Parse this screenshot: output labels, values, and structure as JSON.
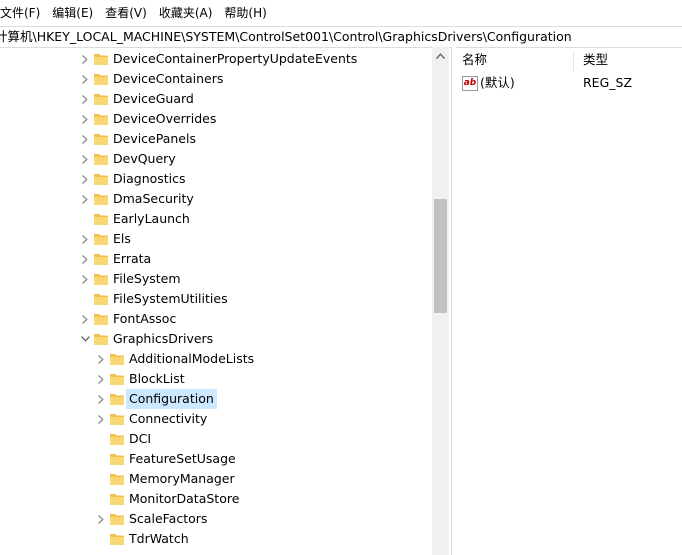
{
  "menubar": {
    "items": [
      "文件(F)",
      "编辑(E)",
      "查看(V)",
      "收藏夹(A)",
      "帮助(H)"
    ]
  },
  "address": {
    "path": "计算机\\HKEY_LOCAL_MACHINE\\SYSTEM\\ControlSet001\\Control\\GraphicsDrivers\\Configuration"
  },
  "tree": {
    "items": [
      {
        "label": "DeviceContainerPropertyUpdateEvents",
        "level": 1,
        "expandable": true,
        "expanded": false
      },
      {
        "label": "DeviceContainers",
        "level": 1,
        "expandable": true,
        "expanded": false
      },
      {
        "label": "DeviceGuard",
        "level": 1,
        "expandable": true,
        "expanded": false
      },
      {
        "label": "DeviceOverrides",
        "level": 1,
        "expandable": true,
        "expanded": false
      },
      {
        "label": "DevicePanels",
        "level": 1,
        "expandable": true,
        "expanded": false
      },
      {
        "label": "DevQuery",
        "level": 1,
        "expandable": true,
        "expanded": false
      },
      {
        "label": "Diagnostics",
        "level": 1,
        "expandable": true,
        "expanded": false
      },
      {
        "label": "DmaSecurity",
        "level": 1,
        "expandable": true,
        "expanded": false
      },
      {
        "label": "EarlyLaunch",
        "level": 1,
        "expandable": false,
        "expanded": false
      },
      {
        "label": "Els",
        "level": 1,
        "expandable": true,
        "expanded": false
      },
      {
        "label": "Errata",
        "level": 1,
        "expandable": true,
        "expanded": false
      },
      {
        "label": "FileSystem",
        "level": 1,
        "expandable": true,
        "expanded": false
      },
      {
        "label": "FileSystemUtilities",
        "level": 1,
        "expandable": false,
        "expanded": false
      },
      {
        "label": "FontAssoc",
        "level": 1,
        "expandable": true,
        "expanded": false
      },
      {
        "label": "GraphicsDrivers",
        "level": 1,
        "expandable": true,
        "expanded": true
      },
      {
        "label": "AdditionalModeLists",
        "level": 2,
        "expandable": true,
        "expanded": false
      },
      {
        "label": "BlockList",
        "level": 2,
        "expandable": true,
        "expanded": false
      },
      {
        "label": "Configuration",
        "level": 2,
        "expandable": true,
        "expanded": false,
        "selected": true
      },
      {
        "label": "Connectivity",
        "level": 2,
        "expandable": true,
        "expanded": false
      },
      {
        "label": "DCI",
        "level": 2,
        "expandable": false,
        "expanded": false
      },
      {
        "label": "FeatureSetUsage",
        "level": 2,
        "expandable": false,
        "expanded": false
      },
      {
        "label": "MemoryManager",
        "level": 2,
        "expandable": false,
        "expanded": false
      },
      {
        "label": "MonitorDataStore",
        "level": 2,
        "expandable": false,
        "expanded": false
      },
      {
        "label": "ScaleFactors",
        "level": 2,
        "expandable": true,
        "expanded": false
      },
      {
        "label": "TdrWatch",
        "level": 2,
        "expandable": false,
        "expanded": false
      }
    ]
  },
  "list": {
    "headers": {
      "name": "名称",
      "type": "类型"
    },
    "rows": [
      {
        "name": "(默认)",
        "type": "REG_SZ",
        "icon": "string-value-icon"
      }
    ]
  },
  "colors": {
    "folder": "#f3c04c",
    "selected": "#cce8ff",
    "scroll_track": "#f0f0f0",
    "scroll_thumb": "#c1c1c1"
  }
}
